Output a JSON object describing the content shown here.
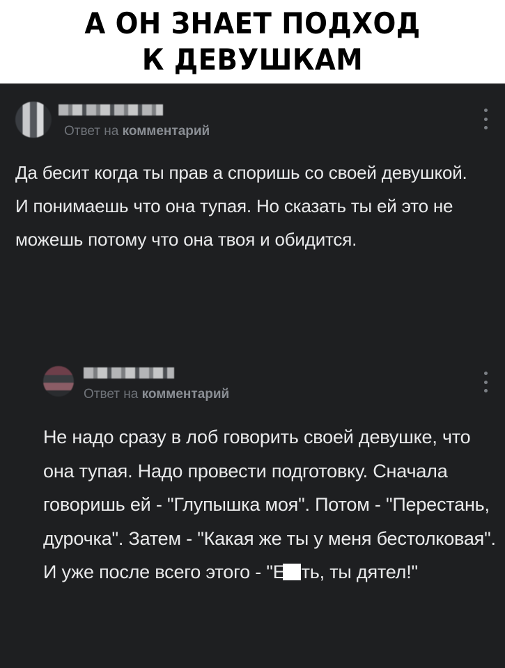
{
  "header": {
    "title_line1": "А ОН ЗНАЕТ ПОДХОД",
    "title_line2": "К ДЕВУШКАМ"
  },
  "colors": {
    "thread_bg": "#1e1f21",
    "text": "#e9eaeb",
    "muted": "#6f7379"
  },
  "comments": [
    {
      "reply_prefix": "Ответ на",
      "reply_target": "комментарий",
      "paragraphs": [
        "Да бесит когда ты прав а споришь со своей девушкой.",
        "И понимаешь что она тупая. Но сказать ты ей это не можешь потому что она твоя и обидится."
      ],
      "more_icon": "vertical-dots-icon"
    },
    {
      "reply_prefix": "Ответ на",
      "reply_target": "комментарий",
      "text_main": "Не надо сразу в лоб говорить своей девушке, что она тупая. Надо провести подготовку. Сначала говоришь ей - \"Глупышка моя\". Потом - \"Перестань, дурочка\". Затем - \"Какая же ты у меня бестолковая\". И уже после всего этого -",
      "text_end_before": "\"Е",
      "text_end_after": "ть, ты дятел!\"",
      "more_icon": "vertical-dots-icon"
    }
  ]
}
